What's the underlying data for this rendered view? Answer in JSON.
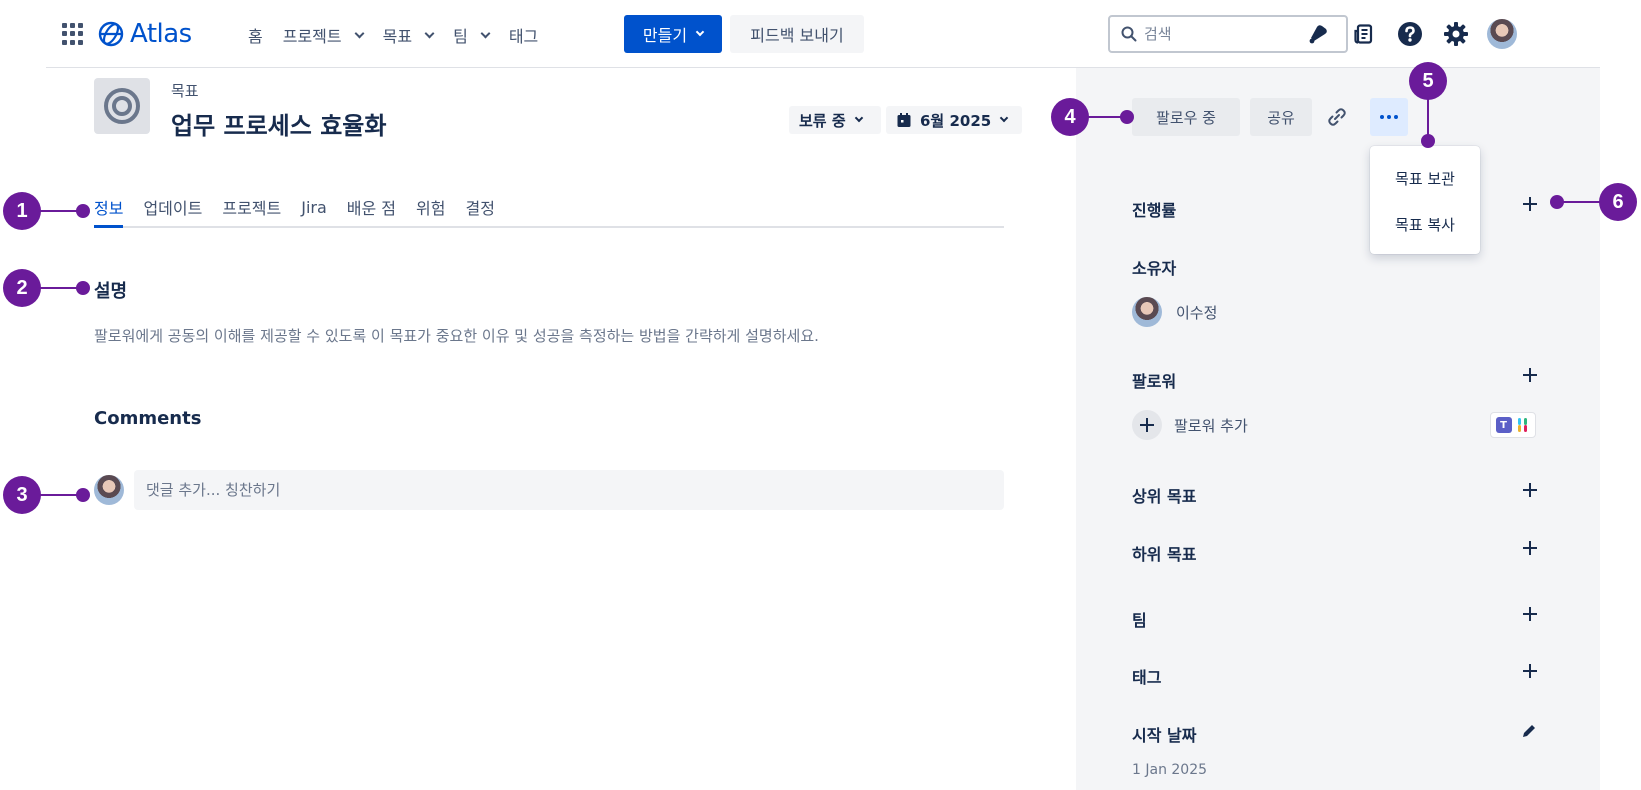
{
  "app": {
    "name": "Atlas"
  },
  "nav": {
    "items": [
      {
        "label": "홈",
        "has_dropdown": false
      },
      {
        "label": "프로젝트",
        "has_dropdown": true
      },
      {
        "label": "목표",
        "has_dropdown": true
      },
      {
        "label": "팀",
        "has_dropdown": true
      },
      {
        "label": "태그",
        "has_dropdown": false
      }
    ],
    "create_label": "만들기",
    "feedback_label": "피드백 보내기",
    "search_placeholder": "검색"
  },
  "goal": {
    "breadcrumb": "목표",
    "title": "업무 프로세스 효율화",
    "status": "보류 중",
    "target_date": "6월 2025"
  },
  "tabs": [
    "정보",
    "업데이트",
    "프로젝트",
    "Jira",
    "배운 점",
    "위험",
    "결정"
  ],
  "active_tab": 0,
  "description": {
    "heading": "설명",
    "placeholder": "팔로워에게 공동의 이해를 제공할 수 있도록 이 목표가 중요한 이유 및 성공을 측정하는 방법을 간략하게 설명하세요."
  },
  "comments": {
    "heading": "Comments",
    "placeholder": "댓글 추가... 칭찬하기"
  },
  "actions": {
    "following_label": "팔로우 중",
    "share_label": "공유",
    "more_menu": [
      "목표 보관",
      "목표 복사"
    ]
  },
  "sidebar": {
    "progress": "진행률",
    "owner_heading": "소유자",
    "owner_name": "이수정",
    "followers_heading": "팔로워",
    "add_follower": "팔로워 추가",
    "parent_goal": "상위 목표",
    "sub_goal": "하위 목표",
    "team": "팀",
    "tags": "태그",
    "start_date_heading": "시작 날짜",
    "start_date": "1 Jan 2025"
  },
  "markers": [
    "1",
    "2",
    "3",
    "4",
    "5",
    "6"
  ],
  "colors": {
    "accent": "#0052cc",
    "marker": "#6a1b9a",
    "panel": "#f4f5f7"
  }
}
